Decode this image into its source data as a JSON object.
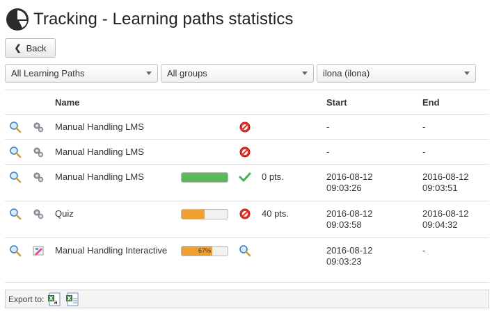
{
  "header": {
    "title": "Tracking - Learning paths statistics",
    "logo_icon": "pie-chart-icon"
  },
  "back_button": {
    "label": "Back",
    "icon": "chevron-left-icon"
  },
  "filters": [
    {
      "value": "All Learning Paths"
    },
    {
      "value": "All groups"
    },
    {
      "value": "ilona (ilona)"
    }
  ],
  "table": {
    "columns": {
      "name": "Name",
      "start": "Start",
      "end": "End"
    },
    "rows": [
      {
        "name": "Manual Handling LMS",
        "type_icon": "gears-icon",
        "status_icon": "not-passed-icon",
        "progress": null,
        "points": "",
        "start_date": "-",
        "start_time": "",
        "end_date": "-",
        "end_time": ""
      },
      {
        "name": "Manual Handling LMS",
        "type_icon": "gears-icon",
        "status_icon": "not-passed-icon",
        "progress": null,
        "points": "",
        "start_date": "-",
        "start_time": "",
        "end_date": "-",
        "end_time": ""
      },
      {
        "name": "Manual Handling LMS",
        "type_icon": "gears-icon",
        "status_icon": "checkmark-icon",
        "progress": 100,
        "progress_color": "#5cb85c",
        "progress_label": "",
        "points": "0 pts.",
        "start_date": "2016-08-12",
        "start_time": "09:03:26",
        "end_date": "2016-08-12",
        "end_time": "09:03:51"
      },
      {
        "name": "Quiz",
        "type_icon": "gears-icon",
        "status_icon": "not-passed-icon",
        "progress": 50,
        "progress_color": "#f0a030",
        "progress_label": "",
        "points": "40 pts.",
        "start_date": "2016-08-12",
        "start_time": "09:03:58",
        "end_date": "2016-08-12",
        "end_time": "09:04:32"
      },
      {
        "name": "Manual Handling Interactive",
        "type_icon": "pencil-icon",
        "status_icon": "magnifier-icon",
        "progress": 67,
        "progress_color": "#f0a030",
        "progress_label": "67%",
        "points": "",
        "start_date": "2016-08-12",
        "start_time": "09:03:23",
        "end_date": "-",
        "end_time": ""
      }
    ]
  },
  "footer": {
    "label": "Export to:",
    "export_icons": [
      "excel-export-icon",
      "csv-export-icon"
    ]
  }
}
